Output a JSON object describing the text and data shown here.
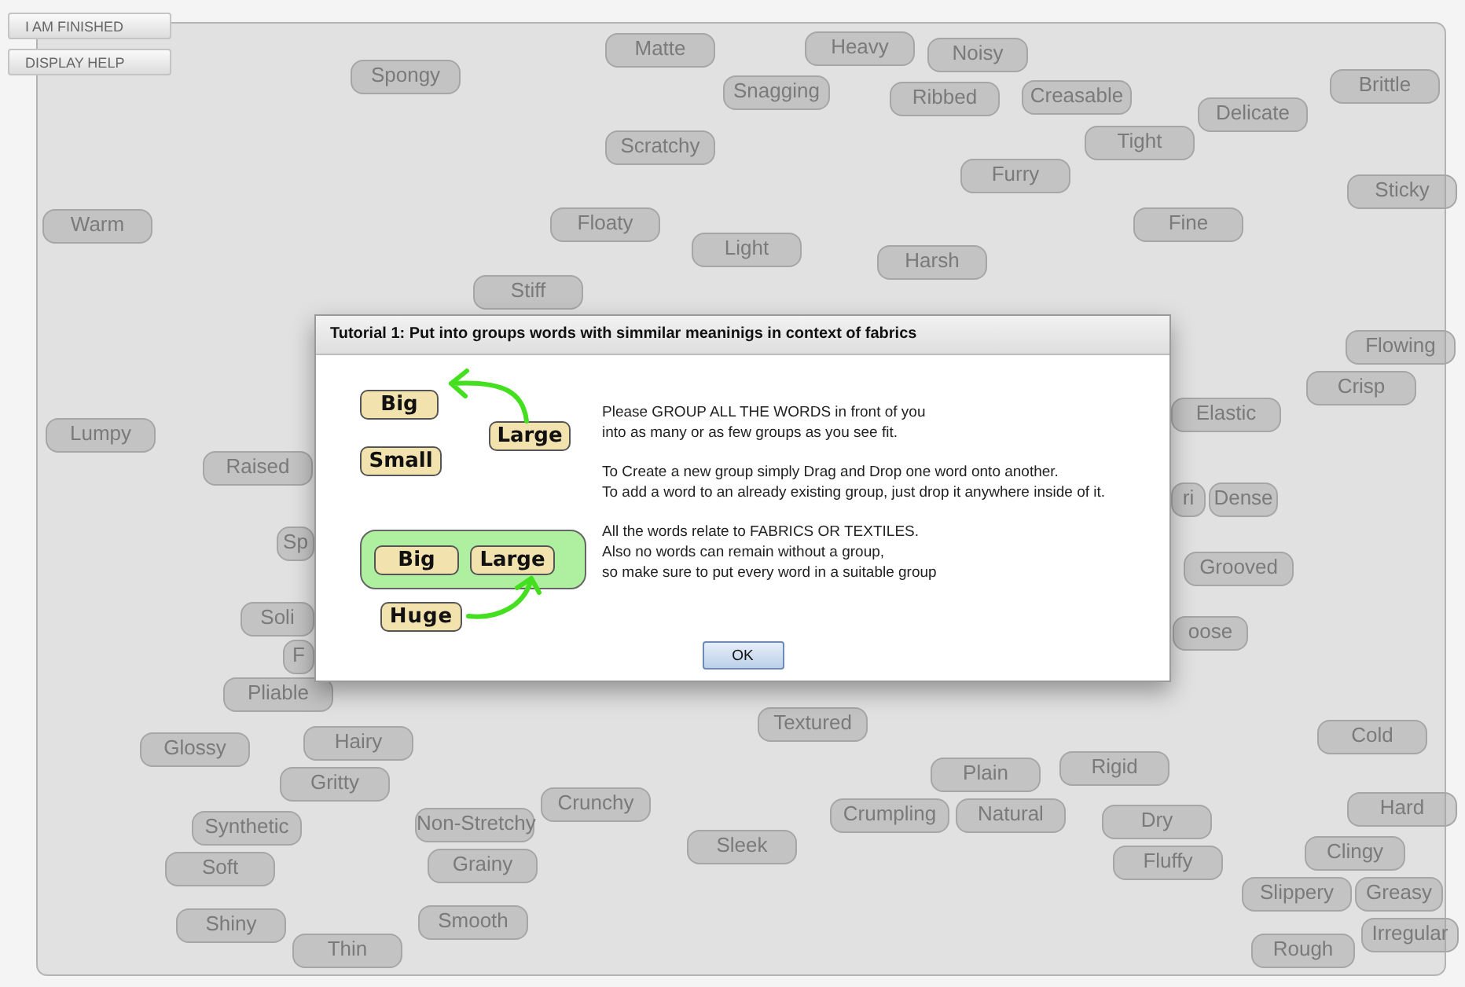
{
  "top_buttons": [
    "I AM FINISHED",
    "DISPLAY HELP"
  ],
  "words": [
    {
      "text": "Spongy"
    },
    {
      "text": "Matte"
    },
    {
      "text": "Heavy"
    },
    {
      "text": "Snagging"
    },
    {
      "text": "Noisy"
    },
    {
      "text": "Ribbed"
    },
    {
      "text": "Creasable"
    },
    {
      "text": "Delicate"
    },
    {
      "text": "Tight"
    },
    {
      "text": "Brittle"
    },
    {
      "text": "Scratchy"
    },
    {
      "text": "Furry"
    },
    {
      "text": "Sticky"
    },
    {
      "text": "Warm"
    },
    {
      "text": "Floaty"
    },
    {
      "text": "Light"
    },
    {
      "text": "Harsh"
    },
    {
      "text": "Fine"
    },
    {
      "text": "Stiff"
    },
    {
      "text": "Flowing"
    },
    {
      "text": "Crisp"
    },
    {
      "text": "Lumpy"
    },
    {
      "text": "Raised"
    },
    {
      "text": "Elastic"
    },
    {
      "text": "Sp"
    },
    {
      "text": "ri"
    },
    {
      "text": "Dense"
    },
    {
      "text": "Grooved"
    },
    {
      "text": "Soli"
    },
    {
      "text": "F"
    },
    {
      "text": "oose"
    },
    {
      "text": "Pliable"
    },
    {
      "text": "Glossy"
    },
    {
      "text": "Hairy"
    },
    {
      "text": "Gritty"
    },
    {
      "text": "Textured"
    },
    {
      "text": "Cold"
    },
    {
      "text": "Rigid"
    },
    {
      "text": "Plain"
    },
    {
      "text": "Crumpling"
    },
    {
      "text": "Natural"
    },
    {
      "text": "Synthetic"
    },
    {
      "text": "Soft"
    },
    {
      "text": "Non-Stretchy"
    },
    {
      "text": "Grainy"
    },
    {
      "text": "Crunchy"
    },
    {
      "text": "Sleek"
    },
    {
      "text": "Dry"
    },
    {
      "text": "Fluffy"
    },
    {
      "text": "Hard"
    },
    {
      "text": "Clingy"
    },
    {
      "text": "Slippery"
    },
    {
      "text": "Greasy"
    },
    {
      "text": "Shiny"
    },
    {
      "text": "Thin"
    },
    {
      "text": "Smooth"
    },
    {
      "text": "Irregular"
    },
    {
      "text": "Rough"
    }
  ],
  "dialog": {
    "title": "Tutorial 1: Put into groups words with simmilar meaninigs in context of fabrics",
    "illustration": {
      "single_words": [
        "Big",
        "Small",
        "Large"
      ],
      "group_words": [
        "Big",
        "Large"
      ],
      "dragged_word": "Huge"
    },
    "paragraphs": [
      [
        "Please GROUP ALL THE WORDS in front of you",
        "into as many or as few groups as you see fit."
      ],
      [
        "To Create a new group simply Drag and Drop one word onto another.",
        "To add a word to an already existing group, just drop it anywhere inside of it."
      ],
      [
        "All the words relate to FABRICS OR TEXTILES.",
        "Also no words can remain without a group,",
        "so make sure to put every word in a suitable group"
      ]
    ],
    "button": "OK"
  }
}
